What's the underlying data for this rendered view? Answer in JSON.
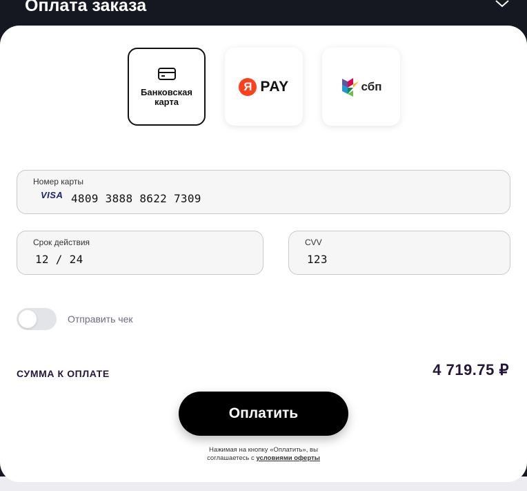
{
  "header": {
    "title": "Оплата заказа",
    "chevron_icon": "chevron-down-icon"
  },
  "payment_methods": [
    {
      "label": "Банковская карта",
      "icon": "card-icon",
      "selected": true
    },
    {
      "label": "PAY",
      "logo_text": "Я",
      "icon": "yandex-pay-logo",
      "selected": false
    },
    {
      "label": "сбп",
      "icon": "sbp-logo",
      "selected": false
    }
  ],
  "card_form": {
    "number_label": "Номер карты",
    "brand": "VISA",
    "number_value": "4809 3888 8622 7309",
    "expiry_label": "Срок действия",
    "expiry_value": "12 / 24",
    "cvv_label": "CVV",
    "cvv_value": "123"
  },
  "receipt": {
    "toggle_label": "Отправить чек",
    "enabled": false
  },
  "summary": {
    "label": "СУММА К ОПЛАТЕ",
    "amount": "4 719.75 ₽"
  },
  "actions": {
    "pay_label": "Оплатить"
  },
  "disclaimer": {
    "line1": "Нажимая на кнопку «Оплатить», вы",
    "line2_prefix": "соглашаетесь с ",
    "link_text": "условиями оферты"
  },
  "colors": {
    "header_bg": "#151821",
    "accent_text": "#24163a",
    "button_bg": "#000000",
    "yandex_red": "#fc3f1d"
  }
}
